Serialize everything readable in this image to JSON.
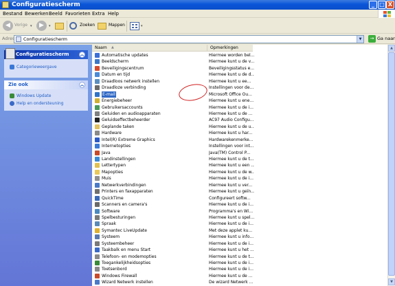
{
  "window": {
    "title": "Configuratiescherm",
    "min_label": "_",
    "max_label": "□",
    "close_label": "X"
  },
  "menu": [
    "Bestand",
    "Bewerken",
    "Beeld",
    "Favorieten",
    "Extra",
    "Help"
  ],
  "toolbar": {
    "back_label": "Vorige",
    "forward_label": "",
    "search_label": "Zoeken",
    "folders_label": "Mappen",
    "back_arrow": "◀",
    "forward_arrow": "▶",
    "dropdown_arrow": "▾"
  },
  "address": {
    "label": "Adres",
    "value": "Configuratiescherm",
    "go_label": "Ga naar",
    "go_arrow": "→",
    "drop_arrow": "▼"
  },
  "leftpane": {
    "panel1": {
      "title": "Configuratiescherm",
      "items": [
        "Categorieweergave"
      ]
    },
    "panel2": {
      "title": "Zie ook",
      "items": [
        "Windows Update",
        "Help en ondersteuning"
      ]
    },
    "chevron": "︽"
  },
  "list": {
    "columns": {
      "name": "Naam",
      "comments": "Opmerkingen",
      "sort_arrow": "▲"
    },
    "items": [
      {
        "name": "Automatische updates",
        "desc": "Hiermee worden bel...",
        "color": "#3b6fd9"
      },
      {
        "name": "Beeldscherm",
        "desc": "Hiermee kunt u de v...",
        "color": "#3c78c8"
      },
      {
        "name": "Beveiligingscentrum",
        "desc": "Beveiligingsstatus e...",
        "color": "#d84a2c"
      },
      {
        "name": "Datum en tijd",
        "desc": "Hiermee kunt u de d...",
        "color": "#4a8ad8"
      },
      {
        "name": "Draadloos netwerk instellen",
        "desc": "Hiermee kunt u ee...",
        "color": "#5a8fc0"
      },
      {
        "name": "Draadloze verbinding",
        "desc": "Instellingen voor de...",
        "color": "#6a6a6a"
      },
      {
        "name": "E-mail",
        "desc": "Microsoft Office Ou...",
        "color": "#2f74c8"
      },
      {
        "name": "Energiebeheer",
        "desc": "Hiermee kunt u ene...",
        "color": "#d0b030"
      },
      {
        "name": "Gebruikersaccounts",
        "desc": "Hiermee kunt u de i...",
        "color": "#4a9a5a"
      },
      {
        "name": "Geluiden en audioapparaten",
        "desc": "Hiermee kunt u de ...",
        "color": "#808080"
      },
      {
        "name": "Geluidseffectbeheerder",
        "desc": "AC97 Audio Configu...",
        "color": "#202020"
      },
      {
        "name": "Geplande taken",
        "desc": "Hiermee kunt u de u...",
        "color": "#e0c060"
      },
      {
        "name": "Hardware",
        "desc": "Hiermee kunt u har...",
        "color": "#8a8a8a"
      },
      {
        "name": "Intel(R) Extreme Graphics",
        "desc": "Hardwarekenmerke...",
        "color": "#2a5ac8"
      },
      {
        "name": "Internetopties",
        "desc": "Instellingen voor int...",
        "color": "#3a7ad8"
      },
      {
        "name": "Java",
        "desc": "Java(TM) Control P...",
        "color": "#c84a2a"
      },
      {
        "name": "Landinstellingen",
        "desc": "Hiermee kunt u de t...",
        "color": "#3a8ad8"
      },
      {
        "name": "Lettertypen",
        "desc": "Hiermee kunt u een ...",
        "color": "#e0c050"
      },
      {
        "name": "Mapopties",
        "desc": "Hiermee kunt u de w...",
        "color": "#e8c858"
      },
      {
        "name": "Muis",
        "desc": "Hiermee kunt u de i...",
        "color": "#909090"
      },
      {
        "name": "Netwerkverbindingen",
        "desc": "Hiermee kunt u ver...",
        "color": "#4a7ac8"
      },
      {
        "name": "Printers en faxapparaten",
        "desc": "Hiermee kunt u geïn...",
        "color": "#707070"
      },
      {
        "name": "QuickTime",
        "desc": "Configureert softw...",
        "color": "#3a6ab8"
      },
      {
        "name": "Scanners en camera's",
        "desc": "Hiermee kunt u de i...",
        "color": "#6a6a6a"
      },
      {
        "name": "Software",
        "desc": "Programma's en Wi...",
        "color": "#4a8ac0"
      },
      {
        "name": "Spelbesturingen",
        "desc": "Hiermee kunt u spel...",
        "color": "#7a7a7a"
      },
      {
        "name": "Spraak",
        "desc": "Hiermee kunt u de i...",
        "color": "#5a8ab8"
      },
      {
        "name": "Symantec LiveUpdate",
        "desc": "Met deze applet ku...",
        "color": "#e0b030"
      },
      {
        "name": "Systeem",
        "desc": "Hiermee kunt u info...",
        "color": "#5a7ab0"
      },
      {
        "name": "Systeembeheer",
        "desc": "Hiermee kunt u de i...",
        "color": "#7a7a7a"
      },
      {
        "name": "Taakbalk en menu Start",
        "desc": "Hiermee kunt u het ...",
        "color": "#3a6ac8"
      },
      {
        "name": "Telefoon- en modemopties",
        "desc": "Hiermee kunt u de t...",
        "color": "#8a8a8a"
      },
      {
        "name": "Toegankelijkheidsopties",
        "desc": "Hiermee kunt u de i...",
        "color": "#3a8a3a"
      },
      {
        "name": "Toetsenbord",
        "desc": "Hiermee kunt u de i...",
        "color": "#8a8a8a"
      },
      {
        "name": "Windows Firewall",
        "desc": "Hiermee kunt u de ...",
        "color": "#c84a2a"
      },
      {
        "name": "Wizard Netwerk instellen",
        "desc": "De wizard Netwerk ...",
        "color": "#4a7ac8"
      }
    ],
    "selected_index": 6
  },
  "scrollbar": {
    "up_arrow": "▲",
    "down_arrow": "▼"
  },
  "colors": {
    "titlebar": "#0a55d8",
    "leftpane": "#6f8ddf",
    "selection": "#316ac5",
    "highlight_circle": "#d02020"
  }
}
